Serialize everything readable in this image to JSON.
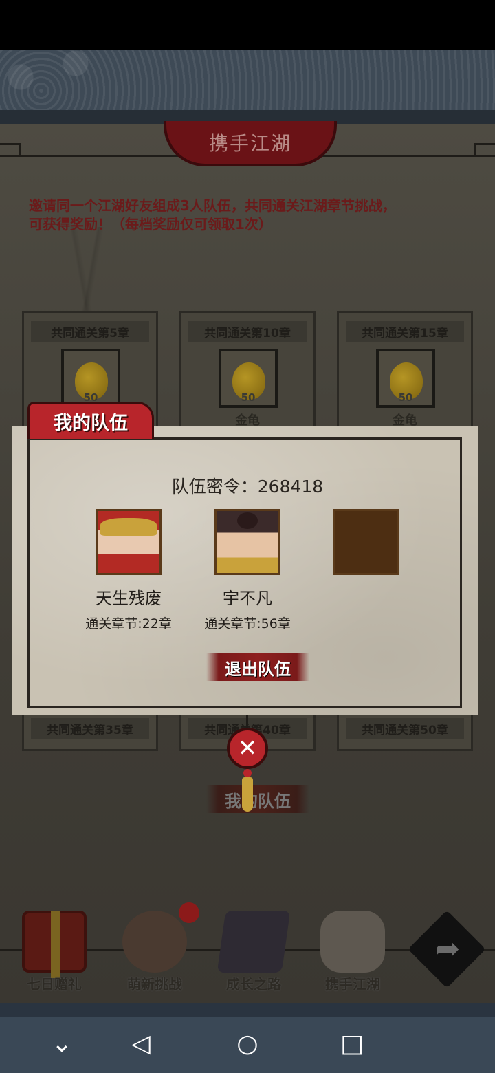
{
  "panel": {
    "title": "携手江湖",
    "description_line1": "邀请同一个江湖好友组成3人队伍，共同通关江湖章节挑战，",
    "description_line2": "可获得奖励！（每档奖励仅可领取1次）"
  },
  "rewards_top": [
    {
      "title": "共同通关第5章",
      "qty": "50",
      "name": "金龟",
      "icon": "gold-gourd-icon"
    },
    {
      "title": "共同通关第10章",
      "qty": "50",
      "name": "金龟",
      "icon": "gold-gourd-icon"
    },
    {
      "title": "共同通关第15章",
      "qty": "50",
      "name": "金龟",
      "icon": "gold-gourd-icon"
    }
  ],
  "rewards_bottom": [
    {
      "title": "共同通关第35章"
    },
    {
      "title": "共同通关第40章"
    },
    {
      "title": "共同通关第50章"
    }
  ],
  "team_popup": {
    "tab_label": "我的队伍",
    "code_label": "队伍密令：268418",
    "members": [
      {
        "name": "天生残废",
        "chapter": "通关章节:22章"
      },
      {
        "name": "宇不凡",
        "chapter": "通关章节:56章"
      }
    ],
    "leave_button": "退出队伍",
    "close_glyph": "✕"
  },
  "my_team_button": "我的队伍",
  "bottom_nav": [
    {
      "label": "七日赠礼",
      "icon": "gift-box-icon"
    },
    {
      "label": "萌新挑战",
      "icon": "novice-character-icon"
    },
    {
      "label": "成长之路",
      "icon": "book-icon"
    },
    {
      "label": "携手江湖",
      "icon": "handshake-icon"
    }
  ],
  "share_icon": "share-arrow-icon",
  "system_nav": {
    "collapse": "⌄",
    "back": "◁",
    "home": "○",
    "recent": "□"
  },
  "colors": {
    "accent_red": "#b8252b",
    "dark_red": "#6a1216",
    "parchment": "#c9c2b3",
    "gold": "#c9a23b"
  }
}
